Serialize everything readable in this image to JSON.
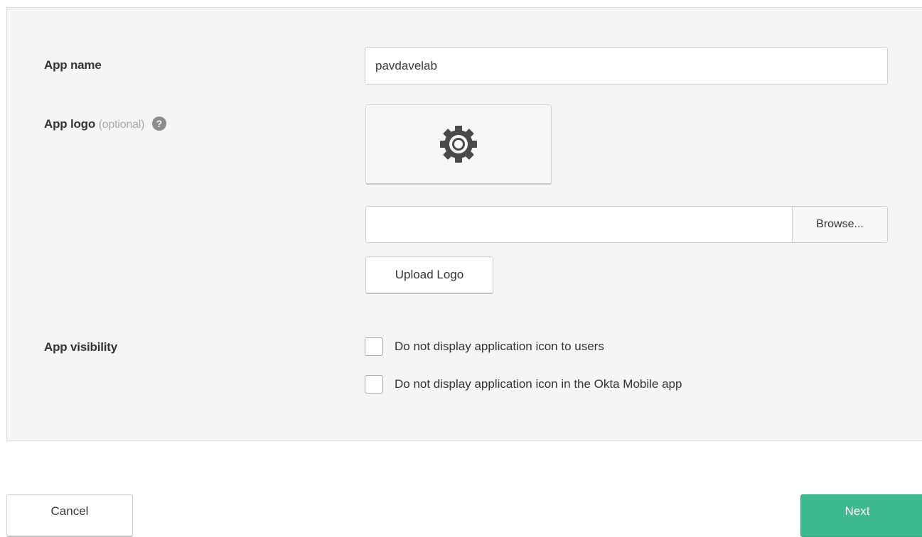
{
  "form": {
    "app_name": {
      "label": "App name",
      "value": "pavdavelab"
    },
    "app_logo": {
      "label": "App logo",
      "optional_note": "(optional)",
      "help_icon": "?",
      "placeholder_icon": "gear-icon",
      "browse_label": "Browse...",
      "upload_label": "Upload Logo"
    },
    "app_visibility": {
      "label": "App visibility",
      "options": [
        {
          "label": "Do not display application icon to users",
          "checked": false
        },
        {
          "label": "Do not display application icon in the Okta Mobile app",
          "checked": false
        }
      ]
    }
  },
  "footer": {
    "cancel_label": "Cancel",
    "next_label": "Next"
  },
  "colors": {
    "primary": "#3cb98e",
    "panel_bg": "#f5f5f5"
  }
}
